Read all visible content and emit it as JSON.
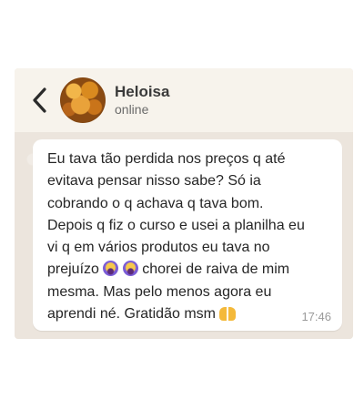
{
  "contact": {
    "name": "Heloisa",
    "status": "online"
  },
  "message": {
    "line1": "Eu tava tão perdida nos preços q até",
    "line2": "evitava pensar nisso sabe? Só ia",
    "line3": "cobrando o q achava q tava bom.",
    "line4": "Depois q fiz o curso e usei a planilha eu",
    "line5": "vi q em vários produtos eu tava no",
    "line6a": "prejuízo",
    "line6b": "chorei de raiva de mim",
    "line7": "mesma. Mas pelo menos agora eu",
    "line8": "aprendi né. Gratidão msm",
    "time": "17:46",
    "emojis": [
      "face-screaming-in-fear",
      "face-screaming-in-fear",
      "raising-hands"
    ]
  },
  "colors": {
    "header_bg": "#f7f3ec",
    "chat_bg": "#ece5dd",
    "bubble_bg": "#ffffff"
  }
}
